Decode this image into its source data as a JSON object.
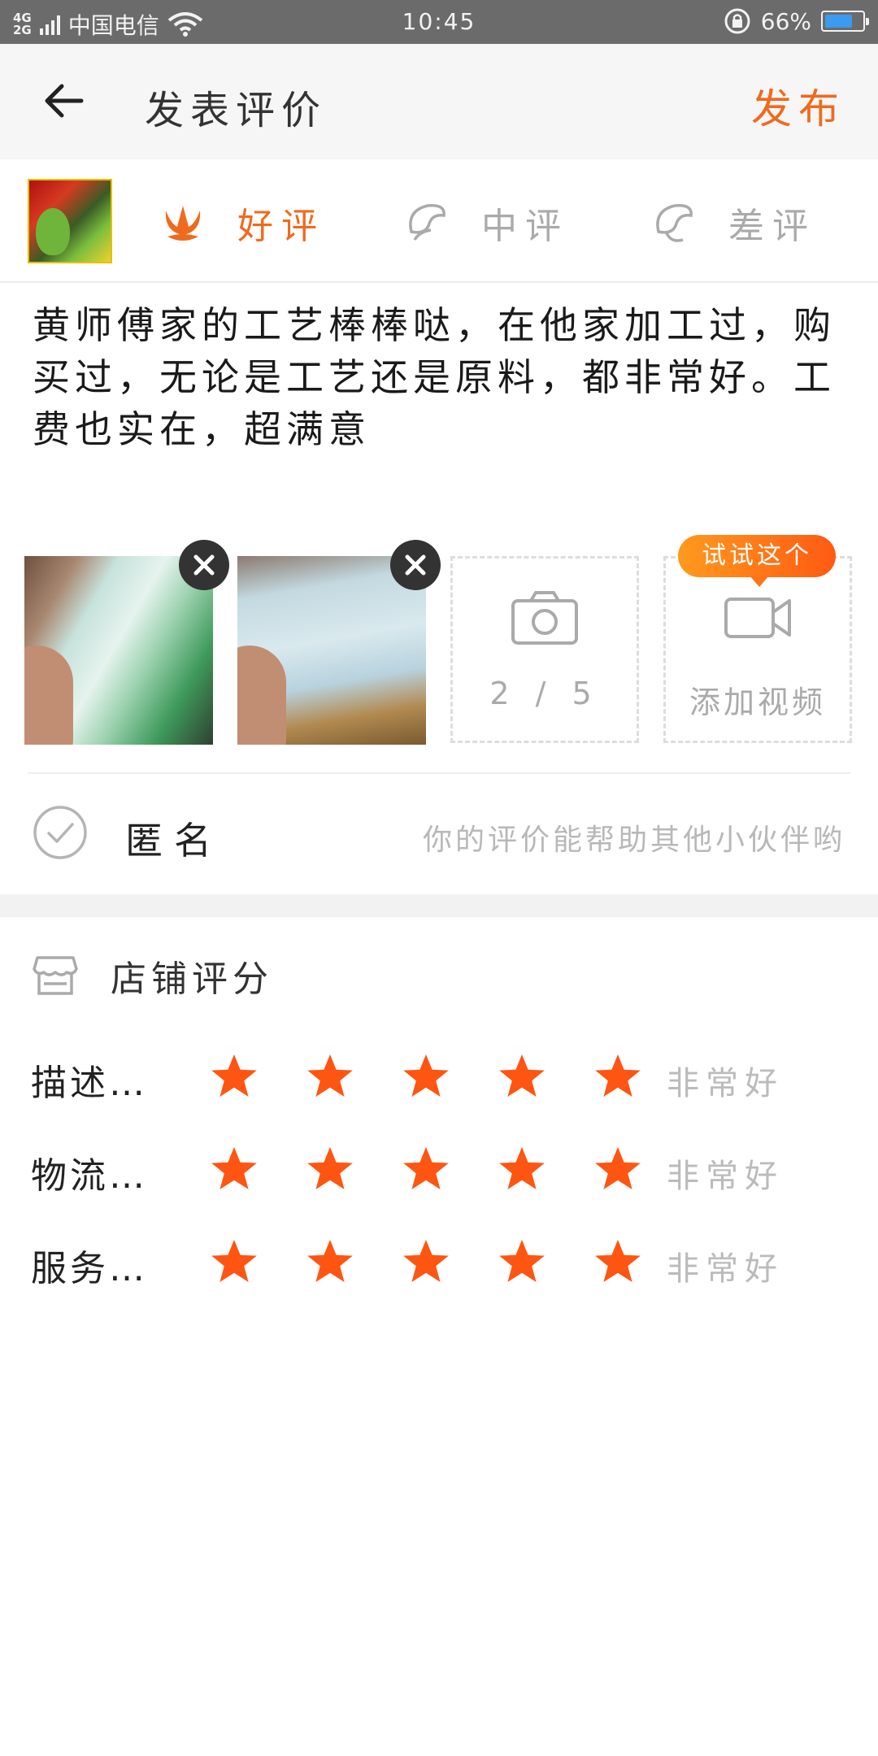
{
  "status_bar": {
    "network_top": "4G",
    "network_bottom": "2G",
    "carrier": "中国电信",
    "time": "10:45",
    "battery": "66%"
  },
  "header": {
    "title": "发表评价",
    "publish": "发布"
  },
  "rating_options": [
    {
      "label": "好评",
      "selected": true
    },
    {
      "label": "中评",
      "selected": false
    },
    {
      "label": "差评",
      "selected": false
    }
  ],
  "review": {
    "text": "黄师傅家的工艺棒棒哒，在他家加工过，购买过，无论是工艺还是原料，都非常好。工费也实在，超满意"
  },
  "media": {
    "photo_count": "2 / 5",
    "add_video_label": "添加视频",
    "tooltip": "试试这个"
  },
  "anonymous": {
    "label": "匿名",
    "hint": "你的评价能帮助其他小伙伴哟"
  },
  "shop_score": {
    "title": "店铺评分",
    "items": [
      {
        "label": "描述…",
        "stars": 5,
        "value": "非常好"
      },
      {
        "label": "物流…",
        "stars": 5,
        "value": "非常好"
      },
      {
        "label": "服务…",
        "stars": 5,
        "value": "非常好"
      }
    ]
  },
  "colors": {
    "accent": "#f06a1e",
    "star": "#ff5512",
    "muted": "#aaaaaa"
  }
}
